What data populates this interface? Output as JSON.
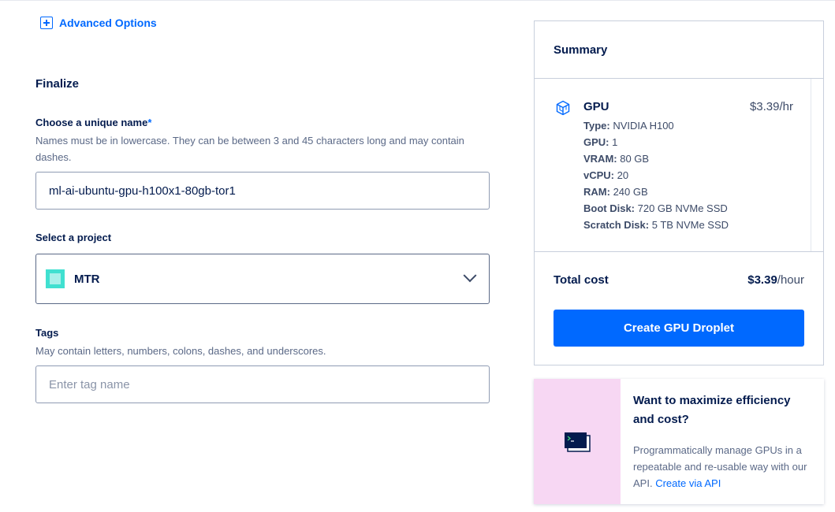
{
  "advanced_options": {
    "label": "Advanced Options"
  },
  "finalize": {
    "title": "Finalize",
    "name_field": {
      "label": "Choose a unique name",
      "required_mark": "*",
      "helper": "Names must be in lowercase. They can be between 3 and 45 characters long and may contain dashes.",
      "value": "ml-ai-ubuntu-gpu-h100x1-80gb-tor1"
    },
    "project_field": {
      "label": "Select a project",
      "selected": "MTR",
      "icon": "project-square-icon"
    },
    "tags_field": {
      "label": "Tags",
      "helper": "May contain letters, numbers, colons, dashes, and underscores.",
      "placeholder": "Enter tag name",
      "value": ""
    }
  },
  "summary": {
    "title": "Summary",
    "item": {
      "icon": "gpu-cube-icon",
      "name": "GPU",
      "price": "$3.39/hr",
      "specs": [
        {
          "label": "Type:",
          "value": "NVIDIA H100"
        },
        {
          "label": "GPU:",
          "value": "1"
        },
        {
          "label": "VRAM:",
          "value": "80 GB"
        },
        {
          "label": "vCPU:",
          "value": "20"
        },
        {
          "label": "RAM:",
          "value": "240 GB"
        },
        {
          "label": "Boot Disk:",
          "value": "720 GB NVMe SSD"
        },
        {
          "label": "Scratch Disk:",
          "value": "5 TB NVMe SSD"
        }
      ]
    },
    "total": {
      "label": "Total cost",
      "amount": "$3.39",
      "unit": "/hour"
    },
    "create_button": "Create GPU Droplet"
  },
  "promo": {
    "icon": "terminal-icon",
    "title": "Want to maximize efficiency and cost?",
    "text": "Programmatically manage GPUs in a repeatable and re-usable way with our API.",
    "link": "Create via API",
    "bg_color": "#f7d7f3"
  },
  "colors": {
    "accent": "#0069ff",
    "text": "#031b4e",
    "muted": "#5b6987"
  }
}
